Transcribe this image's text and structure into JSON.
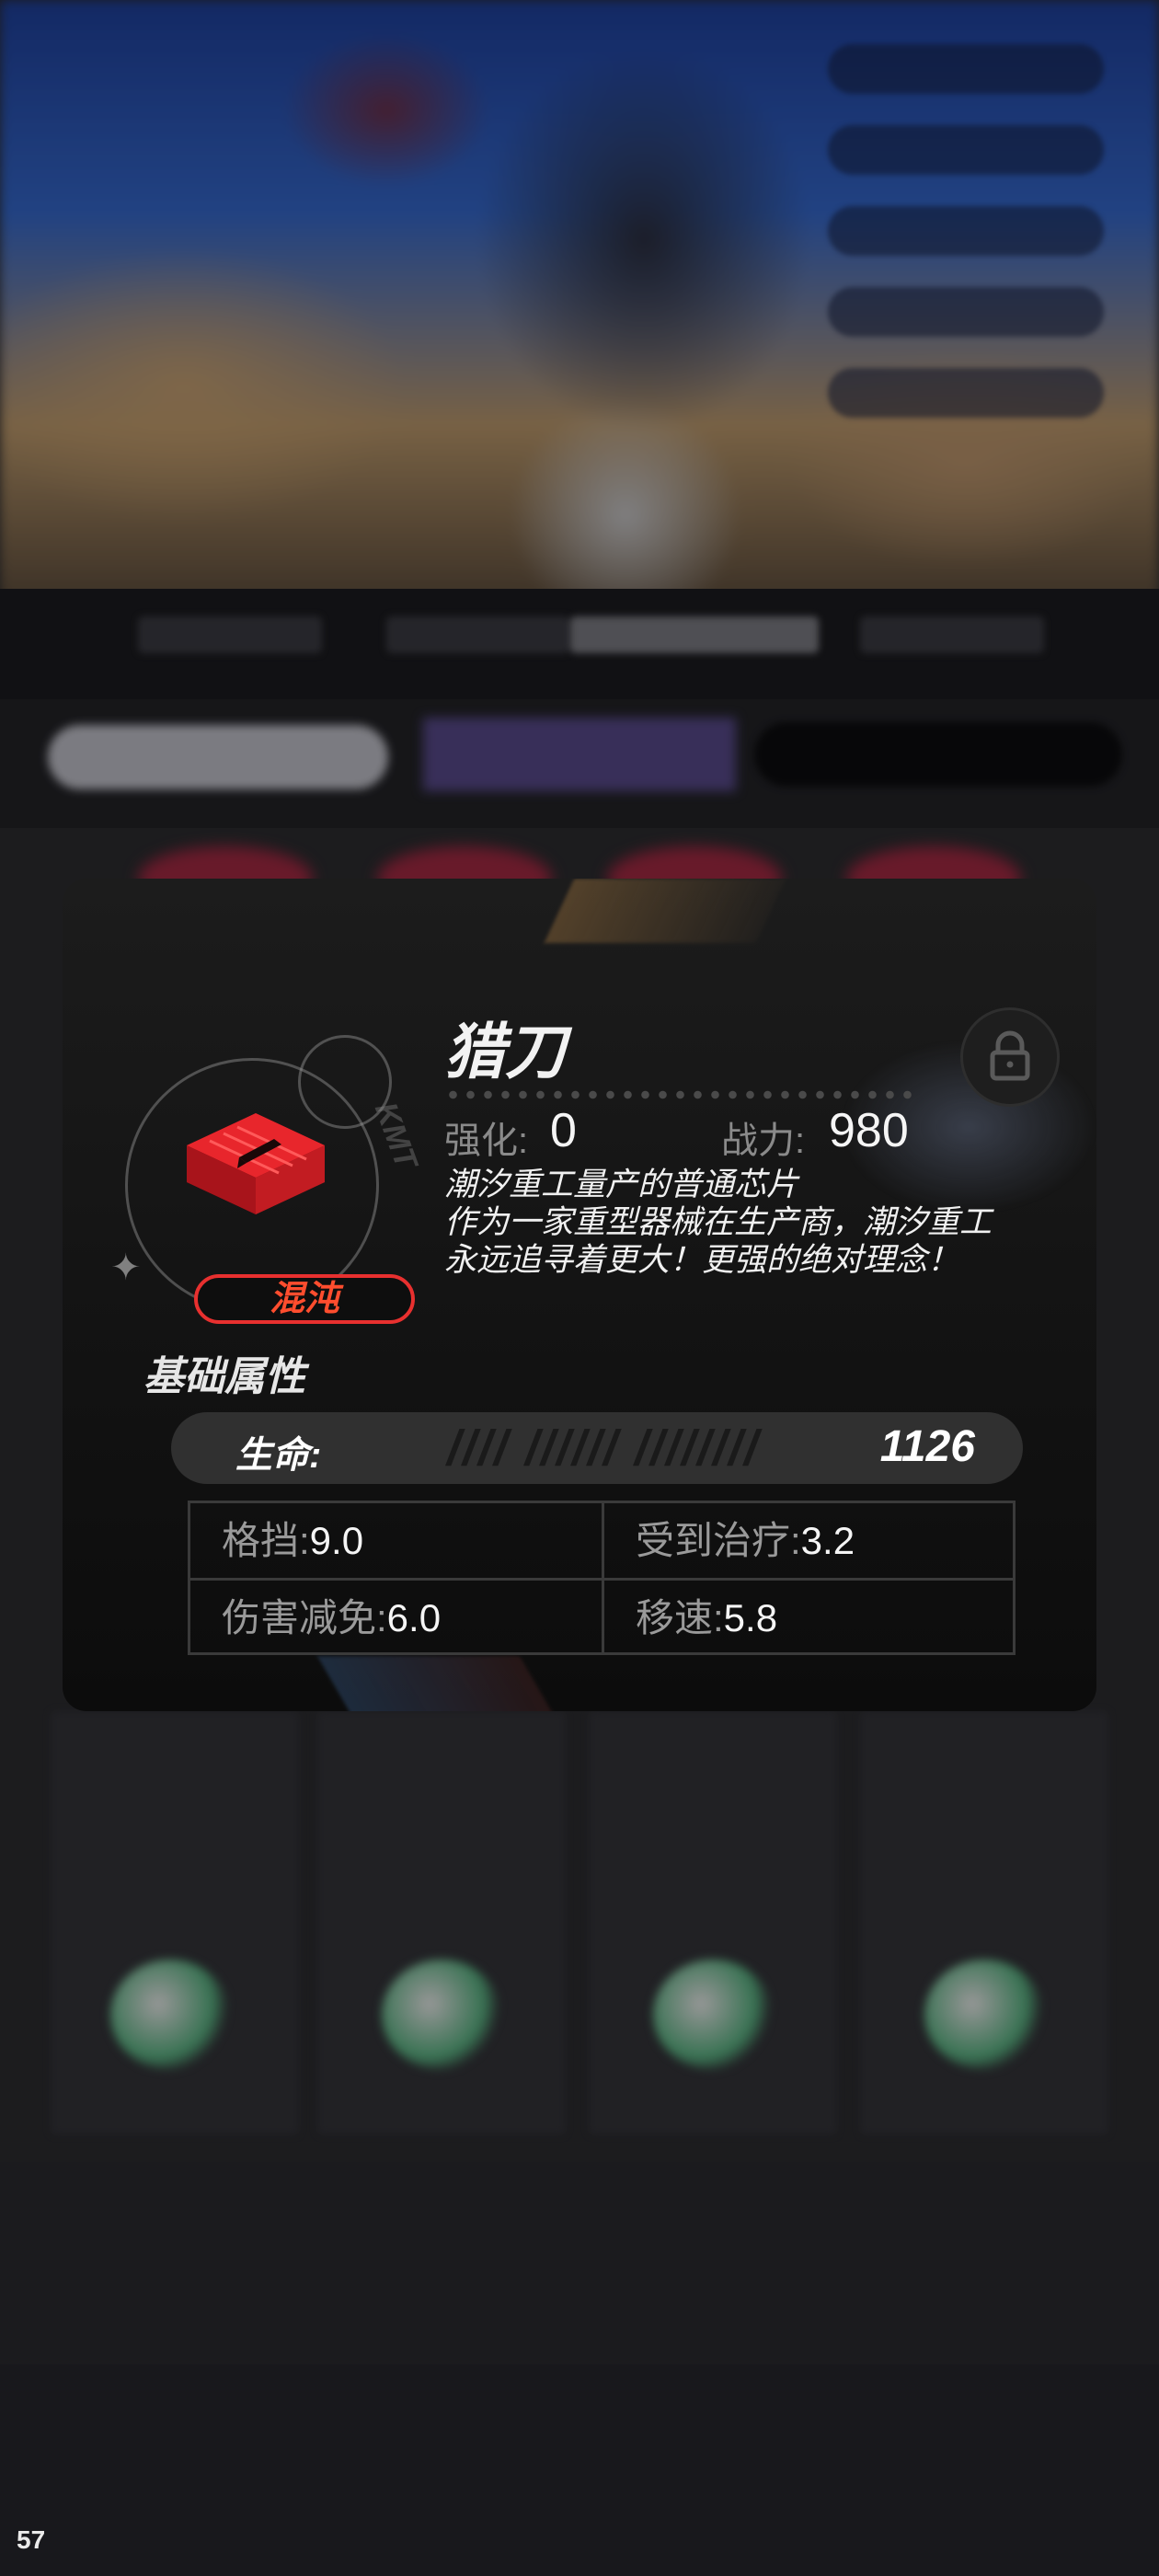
{
  "item": {
    "name": "猎刀",
    "rarity": "混沌",
    "enhance_label": "强化:",
    "enhance_value": "0",
    "power_label": "战力:",
    "power_value": "980",
    "description": [
      "潮汐重工量产的普通芯片",
      "作为一家重型器械在生产商，潮汐重工",
      "永远追寻着更大！更强的绝对理念！"
    ]
  },
  "base_attributes": {
    "title": "基础属性",
    "hp_label": "生命:",
    "hp_value": "1126",
    "stats": [
      {
        "label": "格挡:",
        "value": "9.0"
      },
      {
        "label": "受到治疗:",
        "value": "3.2"
      },
      {
        "label": "伤害减免:",
        "value": "6.0"
      },
      {
        "label": "移速:",
        "value": "5.8"
      }
    ]
  },
  "fps_counter": "57",
  "icons": [
    "chip-icon",
    "lock-icon",
    "sparkle-icon"
  ],
  "colors": {
    "rarity": "#e8302f",
    "card_bg": "#141414",
    "accent_text": "#f5f5f5"
  }
}
